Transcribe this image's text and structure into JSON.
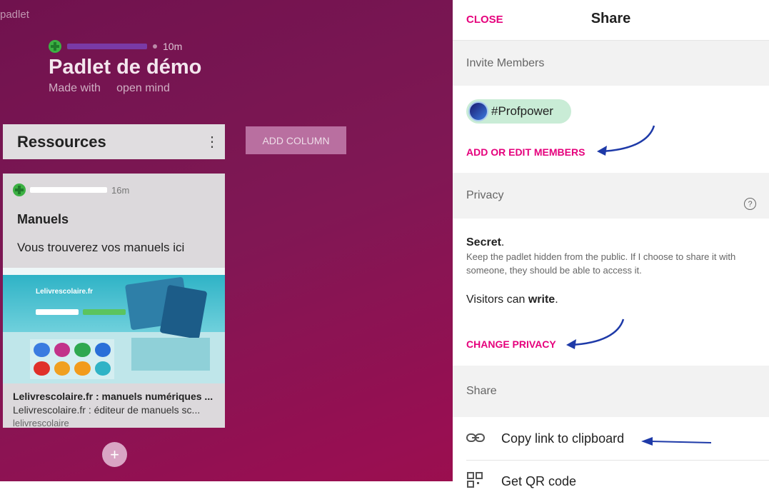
{
  "board": {
    "logo": "padlet",
    "author_time": "10m",
    "title": "Padlet de démo",
    "subtitle": "Made with     open mind",
    "column_title": "Ressources",
    "add_column_label": "ADD COLUMN",
    "card": {
      "time": "16m",
      "title": "Manuels",
      "body": "Vous trouverez vos manuels ici",
      "preview_brand": "Lelivrescolaire.fr",
      "link_title": "Lelivrescolaire.fr : manuels numériques ...",
      "link_desc": "Lelivrescolaire.fr : éditeur de manuels sc...",
      "link_domain": "lelivrescolaire"
    },
    "fab_label": "+"
  },
  "share_panel": {
    "close_label": "CLOSE",
    "title": "Share",
    "invite_header": "Invite Members",
    "member_chip": "#Profpower",
    "add_members_label": "ADD OR EDIT MEMBERS",
    "privacy_header": "Privacy",
    "help_icon": "?",
    "secret_title": "Secret",
    "secret_period": ".",
    "secret_desc": "Keep the padlet hidden from the public. If I choose to share it with someone, they should be able to access it.",
    "visitors_prefix": "Visitors can ",
    "visitors_perm": "write",
    "visitors_suffix": ".",
    "change_privacy_label": "CHANGE PRIVACY",
    "share_header": "Share",
    "copy_link_label": "Copy link to clipboard",
    "qr_label": "Get QR code"
  },
  "colors": {
    "accent": "#e5007c",
    "annotation_arrow": "#1e3aa8",
    "chip_bg": "#c9ecd6"
  },
  "icons": {
    "link": "link-icon",
    "qr": "qr-code-icon",
    "more": "kebab-menu-icon",
    "help": "help-circle-icon"
  }
}
